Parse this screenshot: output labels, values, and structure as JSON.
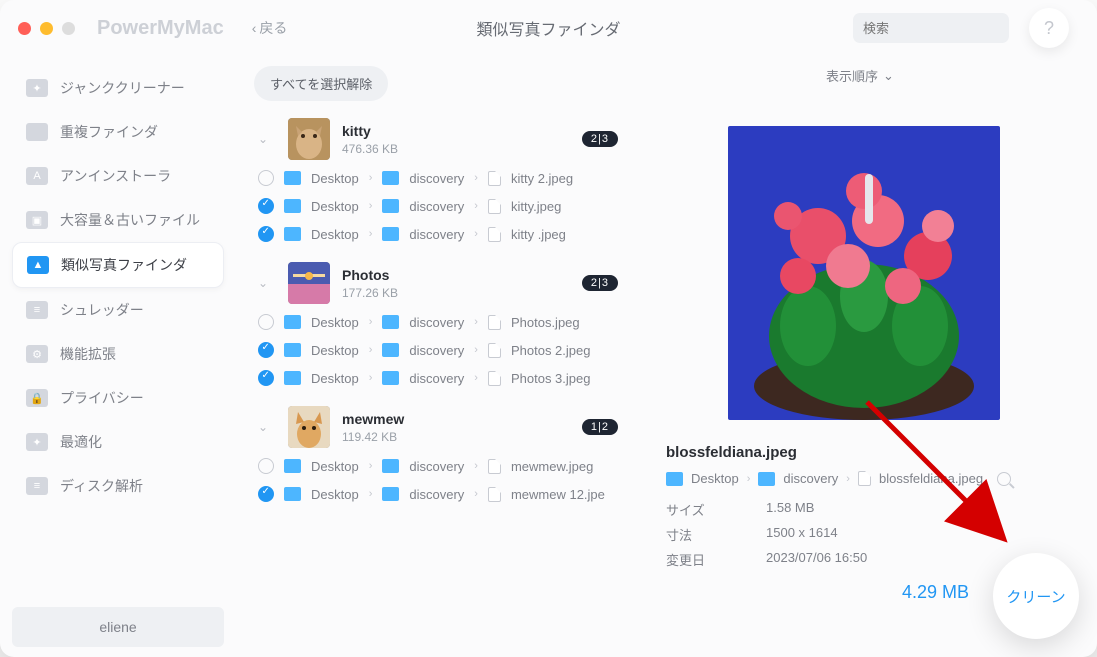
{
  "app": {
    "name": "PowerMyMac",
    "back_label": "戻る",
    "page_title": "類似写真ファインダ"
  },
  "search": {
    "placeholder": "検索"
  },
  "help_label": "?",
  "sidebar": {
    "items": [
      {
        "label": "ジャンククリーナー"
      },
      {
        "label": "重複ファインダ"
      },
      {
        "label": "アンインストーラ"
      },
      {
        "label": "大容量＆古いファイル"
      },
      {
        "label": "類似写真ファインダ"
      },
      {
        "label": "シュレッダー"
      },
      {
        "label": "機能拡張"
      },
      {
        "label": "プライバシー"
      },
      {
        "label": "最適化"
      },
      {
        "label": "ディスク解析"
      }
    ],
    "user": "eliene"
  },
  "toolbar": {
    "deselect_all": "すべてを選択解除",
    "sort": "表示順序"
  },
  "path_parts": {
    "desktop": "Desktop",
    "discovery": "discovery"
  },
  "groups": [
    {
      "name": "kitty",
      "size": "476.36 KB",
      "badge": "2|3",
      "files": [
        {
          "checked": false,
          "name": "kitty 2.jpeg"
        },
        {
          "checked": true,
          "name": "kitty.jpeg"
        },
        {
          "checked": true,
          "name": "kitty .jpeg"
        }
      ]
    },
    {
      "name": "Photos",
      "size": "177.26 KB",
      "badge": "2|3",
      "files": [
        {
          "checked": false,
          "name": "Photos.jpeg"
        },
        {
          "checked": true,
          "name": "Photos 2.jpeg"
        },
        {
          "checked": true,
          "name": "Photos 3.jpeg"
        }
      ]
    },
    {
      "name": "mewmew",
      "size": "119.42 KB",
      "badge": "1|2",
      "files": [
        {
          "checked": false,
          "name": "mewmew.jpeg"
        },
        {
          "checked": true,
          "name": "mewmew 12.jpe"
        }
      ]
    }
  ],
  "detail": {
    "filename": "blossfeldiana.jpeg",
    "path_file": "blossfeldiana.jpeg",
    "size_label": "サイズ",
    "size_value": "1.58 MB",
    "dim_label": "寸法",
    "dim_value": "1500 x 1614",
    "mod_label": "変更日",
    "mod_value": "2023/07/06 16:50"
  },
  "footer": {
    "total": "4.29 MB",
    "clean": "クリーン"
  }
}
